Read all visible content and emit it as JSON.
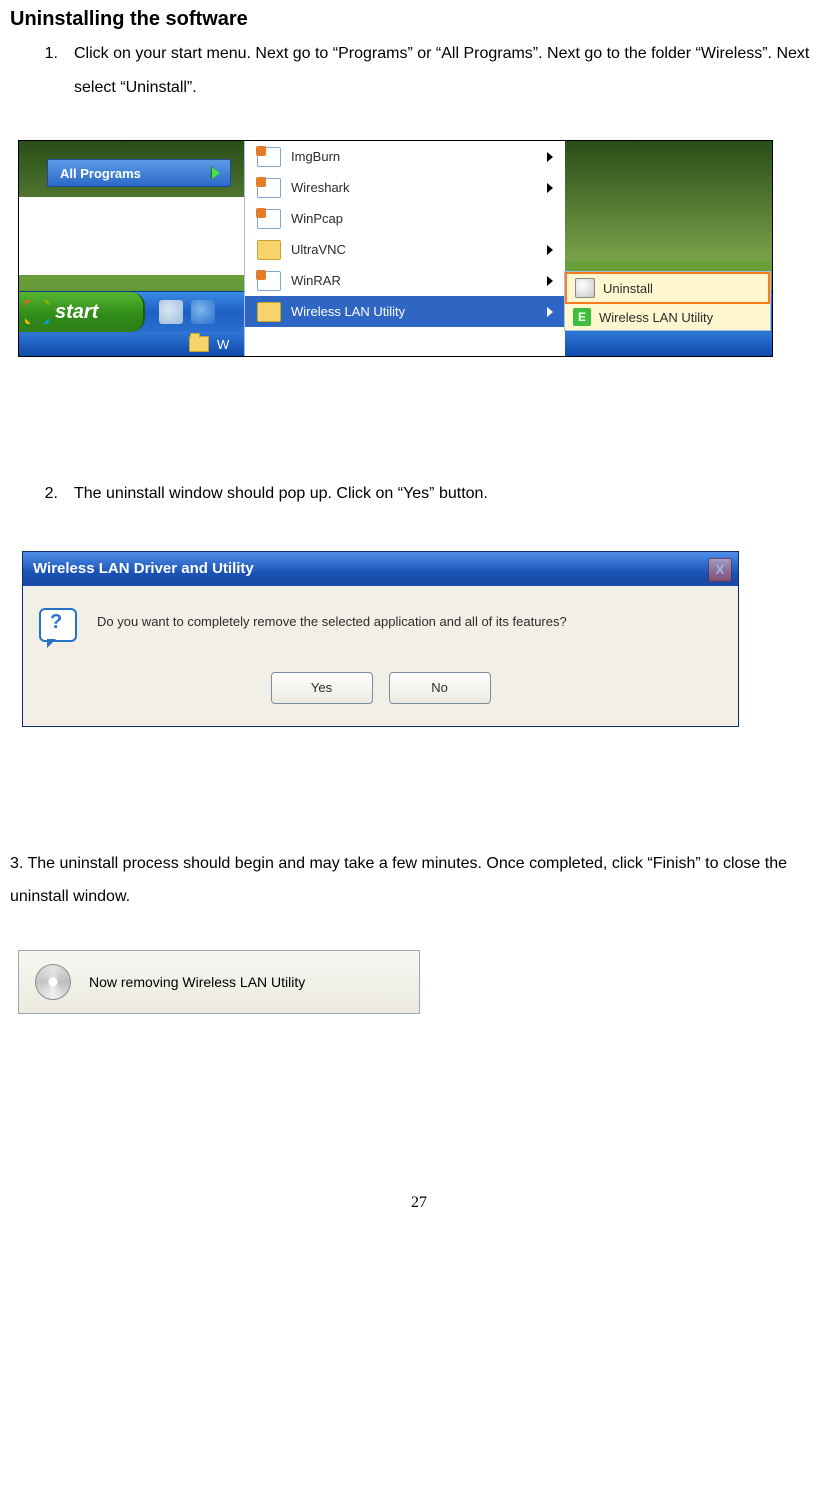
{
  "heading": "Uninstalling the software",
  "steps": {
    "s1_num": "1.",
    "s1_text": "Click on your start menu. Next go to “Programs” or “All Programs”.  Next go to the folder “Wireless”.   Next select “Uninstall”.",
    "s2_num": "2.",
    "s2_text": "The uninstall window should pop up. Click on “Yes” button.",
    "s3_text": "3. The uninstall process should begin and may take a few minutes. Once completed, click “Finish” to close the uninstall window."
  },
  "shot1": {
    "all_programs": "All Programs",
    "start": "start",
    "folder_w": "W",
    "menu": {
      "imgburn": "ImgBurn",
      "wireshark": "Wireshark",
      "winpcap": "WinPcap",
      "ultravnc": "UltraVNC",
      "winrar": "WinRAR",
      "wlan": "Wireless LAN Utility"
    },
    "sub": {
      "uninstall": "Uninstall",
      "util": "Wireless LAN Utility",
      "util_letter": "E"
    }
  },
  "shot2": {
    "title": "Wireless LAN Driver and Utility",
    "close_x": "X",
    "question_mark": "?",
    "message": "Do you want to completely remove the selected application and all of its features?",
    "yes": "Yes",
    "no": "No"
  },
  "shot3": {
    "message": "Now removing Wireless LAN Utility"
  },
  "page_number": "27"
}
